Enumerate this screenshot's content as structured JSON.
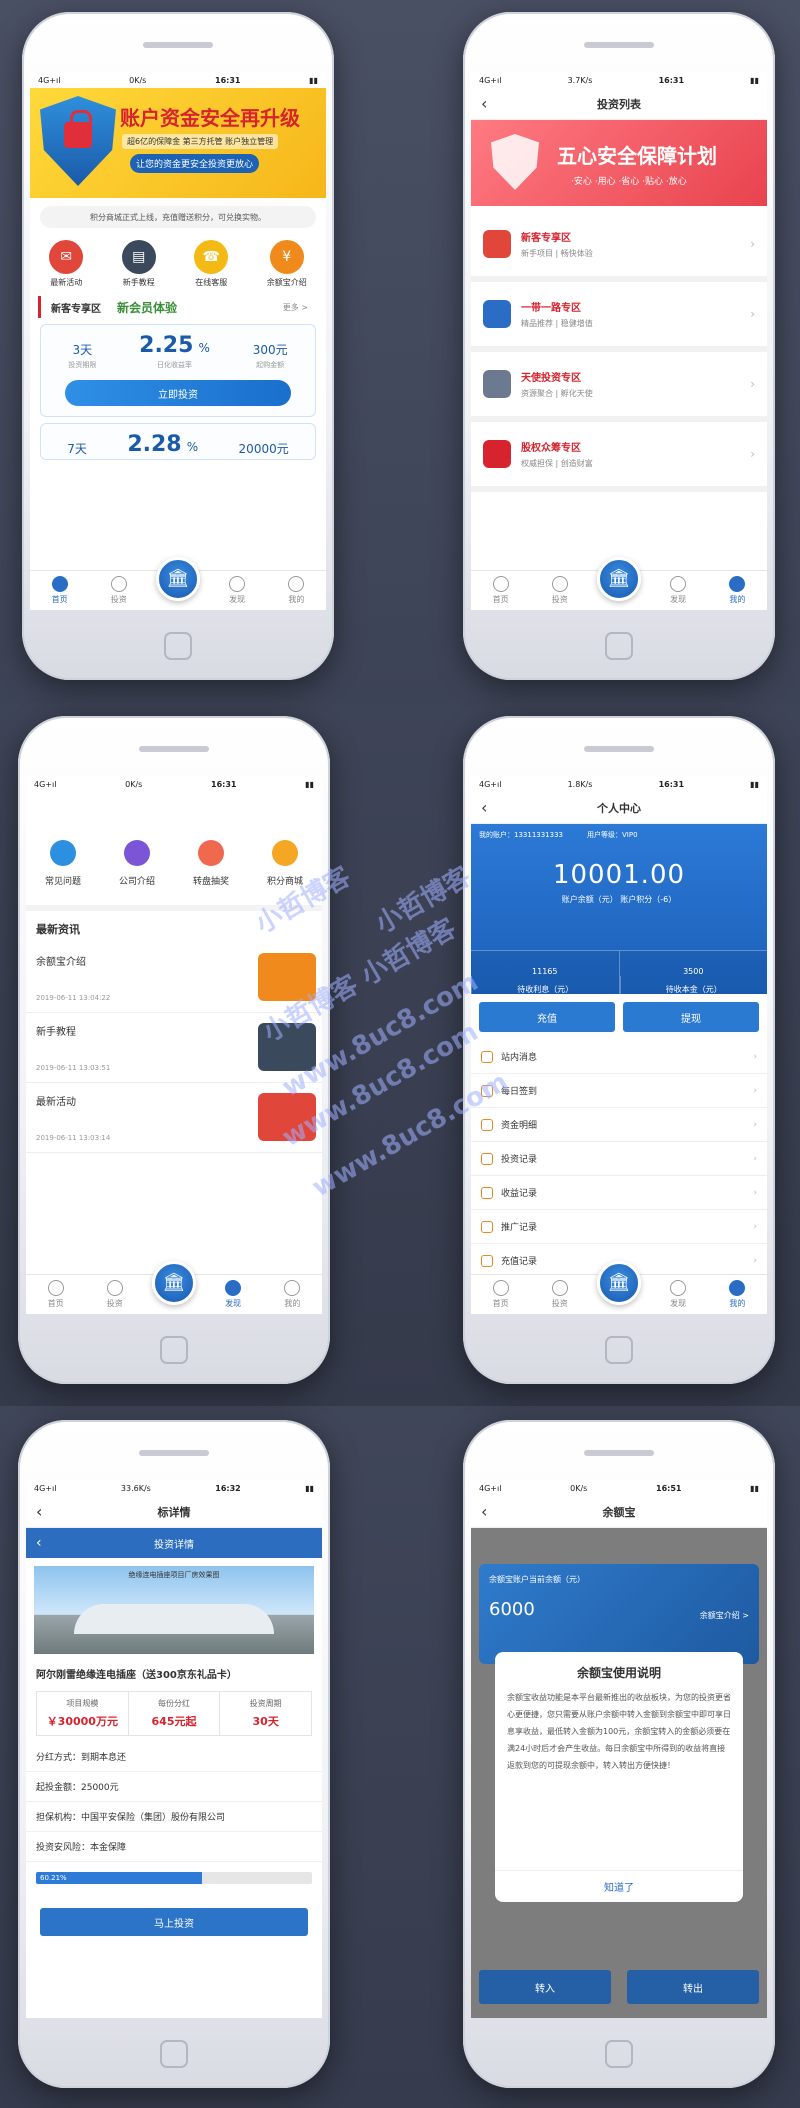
{
  "screens": {
    "home": {
      "status": {
        "net": "4G+ıl",
        "speed": "0K/s",
        "time": "16:31"
      },
      "banner": {
        "title": "账户资金安全再升级",
        "sub": "超6亿的保障金 第三方托管 账户独立管理",
        "sub2": "让您的资金更安全投资更放心"
      },
      "notice": "积分商城正式上线，充值赠送积分，可兑换实物。",
      "quick": [
        "最新活动",
        "新手教程",
        "在线客服",
        "余额宝介绍"
      ],
      "section": {
        "title": "新客专享区",
        "tag": "新会员体验",
        "more": "更多 >"
      },
      "card": {
        "days": "3天",
        "days_label": "投资期限",
        "rate": "2.25",
        "rate_unit": "%",
        "rate_label": "日化收益率",
        "min": "300元",
        "min_label": "起购金额",
        "button": "立即投资"
      },
      "card2": {
        "days": "7天",
        "rate": "2.28",
        "rate_unit": "%",
        "min": "20000元"
      },
      "tabs": [
        "首页",
        "投资",
        "",
        "发现",
        "我的"
      ]
    },
    "list": {
      "status": {
        "net": "4G+ıl",
        "speed": "3.7K/s",
        "time": "16:31"
      },
      "title": "投资列表",
      "banner": {
        "title": "五心安全保障计划",
        "sub": "·安心 ·用心 ·省心 ·贴心 ·放心"
      },
      "zones": [
        {
          "title": "新客专享区",
          "sub": "新手项目 | 畅快体验",
          "color": "#e0463a"
        },
        {
          "title": "一带一路专区",
          "sub": "精品推荐 | 稳健增值",
          "color": "#2b6cc4"
        },
        {
          "title": "天使投资专区",
          "sub": "资源聚合 | 孵化天使",
          "color": "#6b7a8f"
        },
        {
          "title": "股权众筹专区",
          "sub": "权威担保 | 创造财富",
          "color": "#d6232e"
        }
      ],
      "tabs": [
        "首页",
        "投资",
        "",
        "发现",
        "我的"
      ]
    },
    "discover": {
      "status": {
        "net": "4G+ıl",
        "speed": "0K/s",
        "time": "16:31"
      },
      "grid": [
        {
          "label": "常见问题",
          "color": "#2d8fe0"
        },
        {
          "label": "公司介绍",
          "color": "#7b55d6"
        },
        {
          "label": "转盘抽奖",
          "color": "#f0694f"
        },
        {
          "label": "积分商城",
          "color": "#f5a623"
        }
      ],
      "news_head": "最新资讯",
      "news": [
        {
          "title": "余额宝介绍",
          "date": "2019-06-11 13:04:22",
          "color": "#f08a1c"
        },
        {
          "title": "新手教程",
          "date": "2019-06-11 13:03:51",
          "color": "#3a4a5c"
        },
        {
          "title": "最新活动",
          "date": "2019-06-11 13:03:14",
          "color": "#e0463a"
        }
      ],
      "tabs": [
        "首页",
        "投资",
        "",
        "发现",
        "我的"
      ]
    },
    "profile": {
      "status": {
        "net": "4G+ıl",
        "speed": "1.8K/s",
        "time": "16:31"
      },
      "title": "个人中心",
      "account": "我的账户：13311331333",
      "level": "用户等级：VIP0",
      "balance": "10001.00",
      "balance_label": "账户余额（元） 账户积分（-6）",
      "interest": "11165",
      "interest_label": "待收利息（元）",
      "principal": "3500",
      "principal_label": "待收本金（元）",
      "btn_recharge": "充值",
      "btn_withdraw": "提现",
      "menu": [
        "站内消息",
        "每日签到",
        "资金明细",
        "投资记录",
        "收益记录",
        "推广记录",
        "充值记录"
      ],
      "tabs": [
        "首页",
        "投资",
        "",
        "发现",
        "我的"
      ]
    },
    "detail": {
      "status": {
        "net": "4G+ıl",
        "speed": "33.6K/s",
        "time": "16:32"
      },
      "title": "标详情",
      "subtitle": "投资详情",
      "image_caption": "绝缘连电插座项目厂房效果图",
      "product": "阿尔刚雷绝缘连电插座（送300京东礼品卡）",
      "stat_labels": [
        "项目规模",
        "每份分红",
        "投资周期"
      ],
      "stat_values": [
        "￥30000万元",
        "645元起",
        "30天"
      ],
      "dividend": "分红方式：到期本息还",
      "min_amount": "起投金额：25000元",
      "guarantor": "担保机构：中国平安保险（集团）股份有限公司",
      "risk": "投资安风险：本金保障",
      "progress_label": "60.21%",
      "progress": 0.6021,
      "button": "马上投资"
    },
    "yuebao": {
      "status": {
        "net": "4G+ıl",
        "speed": "0K/s",
        "time": "16:51"
      },
      "title": "余额宝",
      "card_title": "余额宝账户当前余额（元）",
      "card_value": "6000",
      "card_link": "余额宝介绍 >",
      "modal_title": "余额宝使用说明",
      "modal_body": "余额宝收益功能是本平台最新推出的收益板块，为您的投资更省心更便捷，您只需要从账户余额中转入金额到余额宝中即可享日息享收益，最低转入金额为100元，余额宝转入的金额必须要在满24小时后才会产生收益。每日余额宝中所得到的收益将直接返款到您的可提现余额中，转入转出方便快捷！",
      "modal_ok": "知道了",
      "btn_in": "转入",
      "btn_out": "转出"
    }
  },
  "watermark": [
    "小哲博客",
    "小哲博客",
    "小哲博客 小哲博客",
    "www.8uc8.com",
    "www.8uc8.com",
    "www.8uc8.com"
  ]
}
